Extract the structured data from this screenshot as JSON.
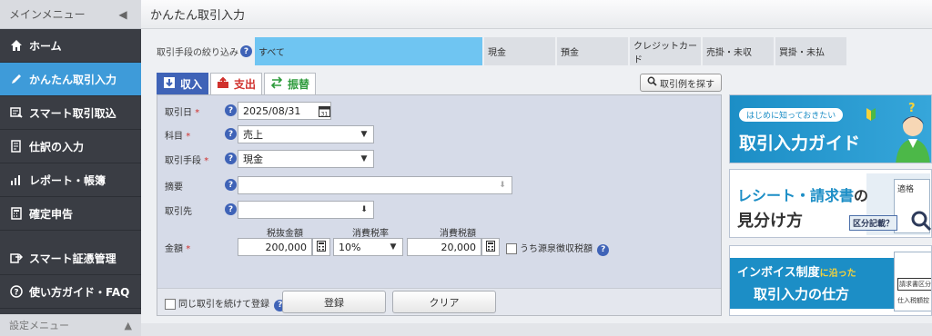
{
  "sidebar": {
    "header_label": "メインメニュー",
    "items": [
      {
        "label": "ホーム",
        "icon": "home-icon"
      },
      {
        "label": "かんたん取引入力",
        "icon": "pencil-icon",
        "active": true
      },
      {
        "label": "スマート取引取込",
        "icon": "import-icon"
      },
      {
        "label": "仕訳の入力",
        "icon": "journal-icon"
      },
      {
        "label": "レポート・帳簿",
        "icon": "report-icon"
      },
      {
        "label": "確定申告",
        "icon": "calculator-icon"
      },
      {
        "label": "スマート証憑管理",
        "icon": "receipt-icon"
      },
      {
        "label": "使い方ガイド・FAQ",
        "icon": "question-icon"
      }
    ],
    "footer_label": "設定メニュー"
  },
  "header": {
    "title": "かんたん取引入力"
  },
  "filter": {
    "label": "取引手段の絞り込み",
    "tabs": [
      "すべて",
      "現金",
      "預金",
      "クレジットカード",
      "売掛・未収",
      "買掛・未払"
    ],
    "selected": "すべて"
  },
  "tabs": {
    "income": "収入",
    "expense": "支出",
    "transfer": "振替"
  },
  "example_button": "取引例を探す",
  "form": {
    "date_label": "取引日",
    "date_value": "2025/08/31",
    "account_label": "科目",
    "account_value": "売上",
    "method_label": "取引手段",
    "method_value": "現金",
    "memo_label": "摘要",
    "memo_value": "",
    "partner_label": "取引先",
    "partner_value": "",
    "amount_label": "金額",
    "required_mark": "*",
    "pre_tax_label": "税抜金額",
    "pre_tax_value": "200,000",
    "tax_rate_label": "消費税率",
    "tax_rate_value": "10%",
    "tax_amount_label": "消費税額",
    "tax_amount_value": "20,000",
    "withholding_label": "うち源泉徴収税額"
  },
  "bottom": {
    "repeat_label": "同じ取引を続けて登録",
    "register_button": "登録",
    "clear_button": "クリア"
  },
  "banners": {
    "guide_small": "はじめに知っておきたい",
    "guide_title": "取引入力ガイド",
    "receipt_line1": "レシート・請求書",
    "receipt_particle": "の",
    "receipt_line2": "見分け方",
    "receipt_tag": "区分記載？",
    "receipt_side": "適格",
    "invoice_line1": "インボイス制度",
    "invoice_particle": "に沿った",
    "invoice_line2": "取引入力の仕方",
    "invoice_doc1": "請求書区分",
    "invoice_doc2": "仕入税額控"
  },
  "colors": {
    "accent": "#3e9bd9",
    "sidebar": "#3a3d44",
    "income_tab": "#3f63b7",
    "expense": "#d0312d",
    "transfer": "#2e9b3c",
    "selected_filter": "#6fc5f2"
  }
}
